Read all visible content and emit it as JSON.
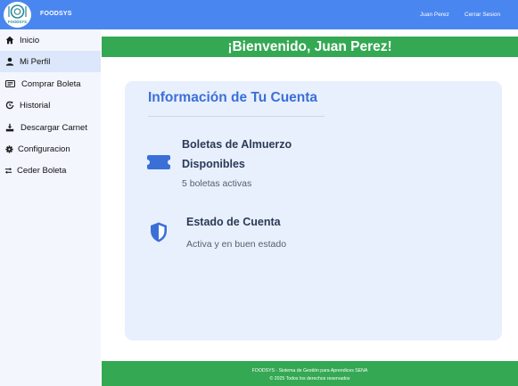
{
  "header": {
    "brand": "FOODSYS",
    "logo_text": "FOODSYS",
    "user_name": "Juan Perez",
    "logout_label": "Cerrar Sesion",
    "background_color": "#4a86f0"
  },
  "sidebar": {
    "items": [
      {
        "label": "Inicio",
        "icon": "home-icon",
        "active": false
      },
      {
        "label": "Mi Perfil",
        "icon": "user-icon",
        "active": true
      },
      {
        "label": "Comprar Boleta",
        "icon": "ticket-icon",
        "active": false
      },
      {
        "label": "Historial",
        "icon": "history-icon",
        "active": false
      },
      {
        "label": "Descargar Carnet",
        "icon": "download-icon",
        "active": false
      },
      {
        "label": "Configuracion",
        "icon": "gear-icon",
        "active": false
      },
      {
        "label": "Ceder Boleta",
        "icon": "transfer-icon",
        "active": false
      }
    ]
  },
  "main": {
    "welcome": "¡Bienvenido, Juan Perez!",
    "card": {
      "title": "Información de Tu Cuenta",
      "tickets": {
        "title": "Boletas de Almuerzo Disponibles",
        "value": "5 boletas activas",
        "icon": "ticket-icon"
      },
      "status": {
        "title": "Estado de Cuenta",
        "value": "Activa y en buen estado",
        "icon": "shield-icon"
      }
    }
  },
  "footer": {
    "line1": "FOODSYS - Sistema de Gestión para Aprendices SENA",
    "line2": "© 2025 Todos los derechos reservados"
  },
  "colors": {
    "accent_blue": "#4a86f0",
    "accent_green": "#34a853",
    "card_background": "#e8f0fe",
    "title_blue": "#3b6fd8"
  }
}
